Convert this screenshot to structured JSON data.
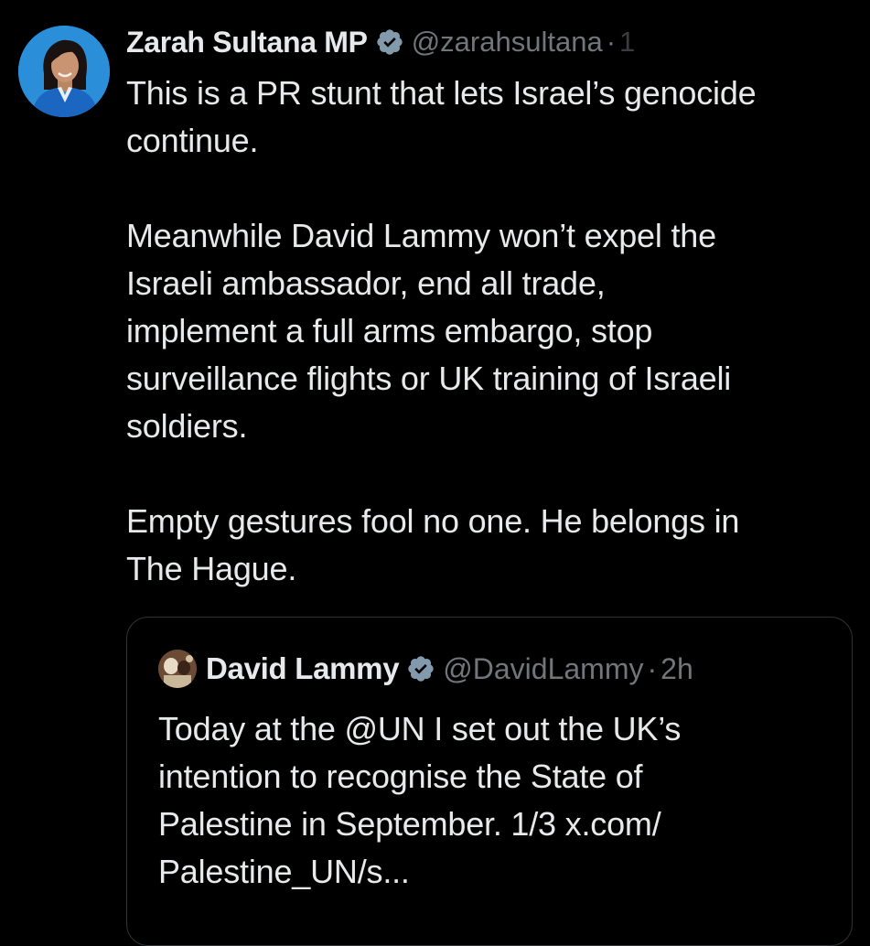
{
  "tweet": {
    "author": {
      "display_name": "Zarah Sultana MP",
      "handle": "@zarahsultana",
      "separator": "·",
      "time": "1",
      "verified_icon": "verified-badge-icon",
      "avatar": "profile-avatar"
    },
    "paragraphs": [
      "This is a PR stunt that lets Israel’s genocide\ncontinue.",
      "Meanwhile David Lammy won’t expel the\nIsraeli ambassador, end all trade,\nimplement a full arms embargo, stop\nsurveillance flights or UK training of Israeli\nsoldiers.",
      "Empty gestures fool no one. He belongs in\nThe Hague."
    ]
  },
  "quoted_tweet": {
    "author": {
      "display_name": "David Lammy",
      "handle": "@DavidLammy",
      "separator": "·",
      "time": "2h",
      "verified_icon": "verified-badge-icon",
      "avatar": "quoted-avatar"
    },
    "text": "Today at the @UN I set out the UK’s\nintention to recognise the State of\nPalestine in September. 1/3 x.com/\nPalestine_UN/s..."
  },
  "colors": {
    "background": "#000000",
    "text_primary": "#e7e9ea",
    "text_secondary": "#71767b",
    "border": "#2f3336",
    "verified_badge": "#829aab"
  }
}
